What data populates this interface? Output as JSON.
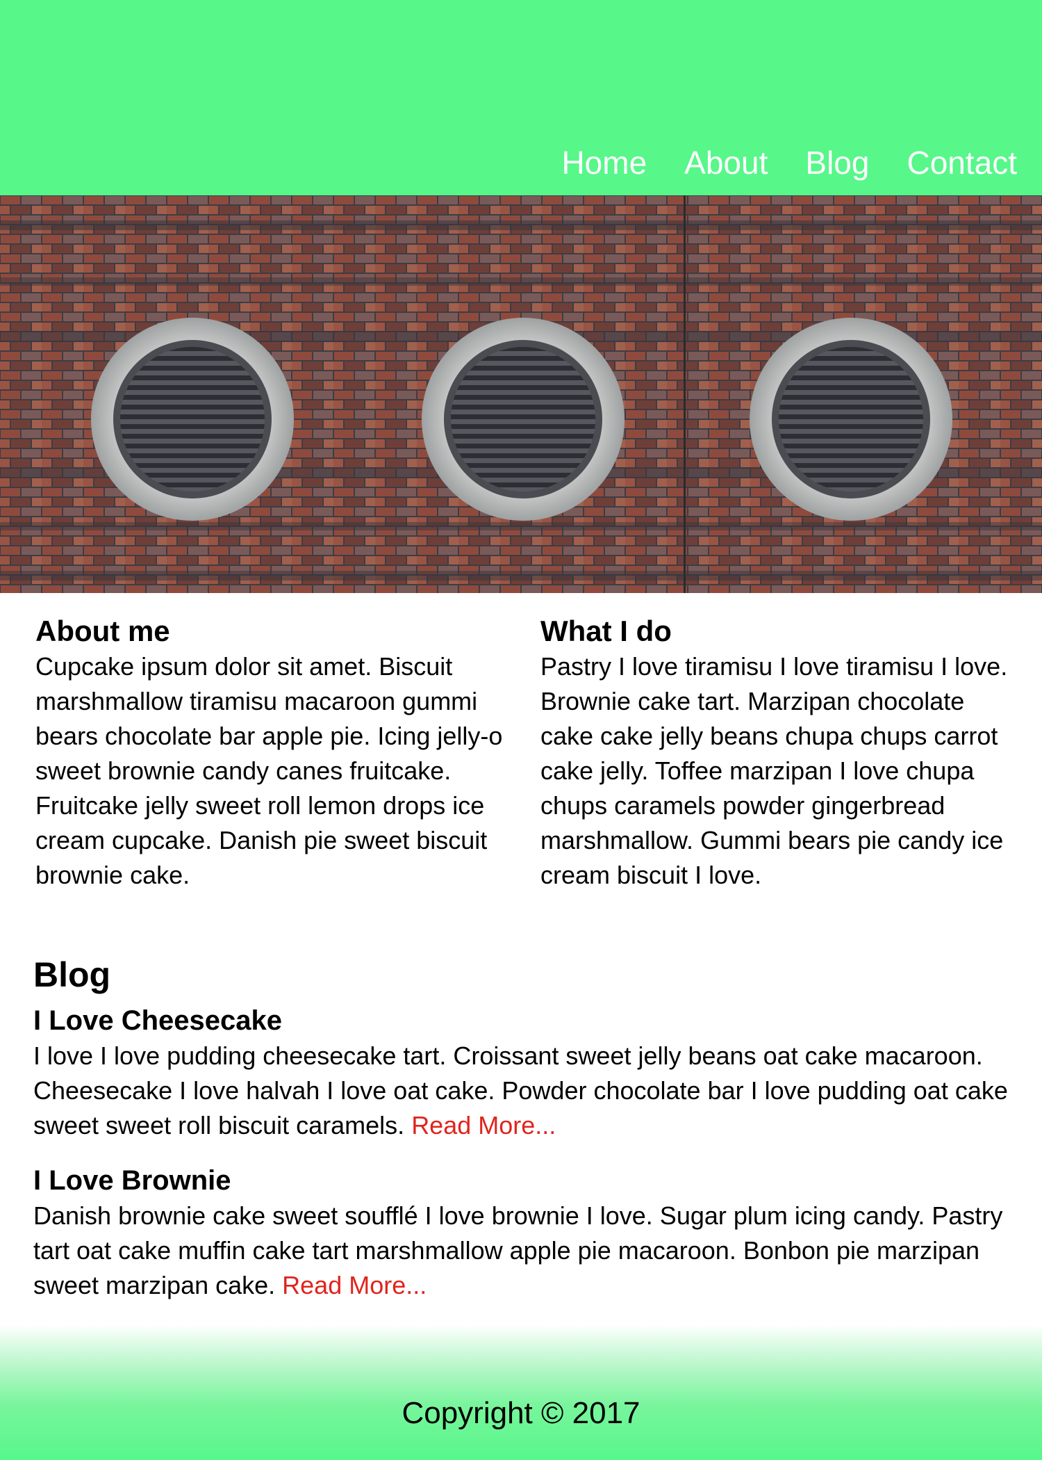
{
  "nav": {
    "items": [
      {
        "label": "Home"
      },
      {
        "label": "About"
      },
      {
        "label": "Blog"
      },
      {
        "label": "Contact"
      }
    ]
  },
  "hero": {
    "description": "brick-wall-with-three-round-vents",
    "colors": {
      "brick": "#8a4a3c",
      "vent_frame": "#b9bbbb",
      "louver": "#3b3d42"
    }
  },
  "about": {
    "title": "About me",
    "text": "Cupcake ipsum dolor sit amet. Biscuit marshmallow tiramisu macaroon gummi bears chocolate bar apple pie. Icing jelly-o sweet brownie candy canes fruitcake. Fruitcake jelly sweet roll lemon drops ice cream cupcake. Danish pie sweet biscuit brownie cake."
  },
  "what": {
    "title": "What I do",
    "text": "Pastry I love tiramisu I love tiramisu I love. Brownie cake tart. Marzipan chocolate cake cake jelly beans chupa chups carrot cake jelly. Toffee marzipan I love chupa chups caramels powder gingerbread marshmallow. Gummi bears pie candy ice cream biscuit I love."
  },
  "blog": {
    "title": "Blog",
    "posts": [
      {
        "title": "I Love Cheesecake",
        "text": "I love I love pudding cheesecake tart. Croissant sweet jelly beans oat cake macaroon. Cheesecake I love halvah I love oat cake. Powder chocolate bar I love pudding oat cake sweet sweet roll biscuit caramels. ",
        "link": "Read More..."
      },
      {
        "title": "I Love Brownie",
        "text": "Danish brownie cake sweet soufflé I love brownie I love. Sugar plum icing candy. Pastry tart oat cake muffin cake tart marshmallow apple pie macaroon. Bonbon pie marzipan sweet marzipan cake. ",
        "link": "Read More..."
      }
    ]
  },
  "footer": {
    "copyright": "Copyright © 2017"
  },
  "colors": {
    "header_bg": "#57f78a",
    "nav_text": "#ffffff",
    "link": "#e0241d"
  }
}
